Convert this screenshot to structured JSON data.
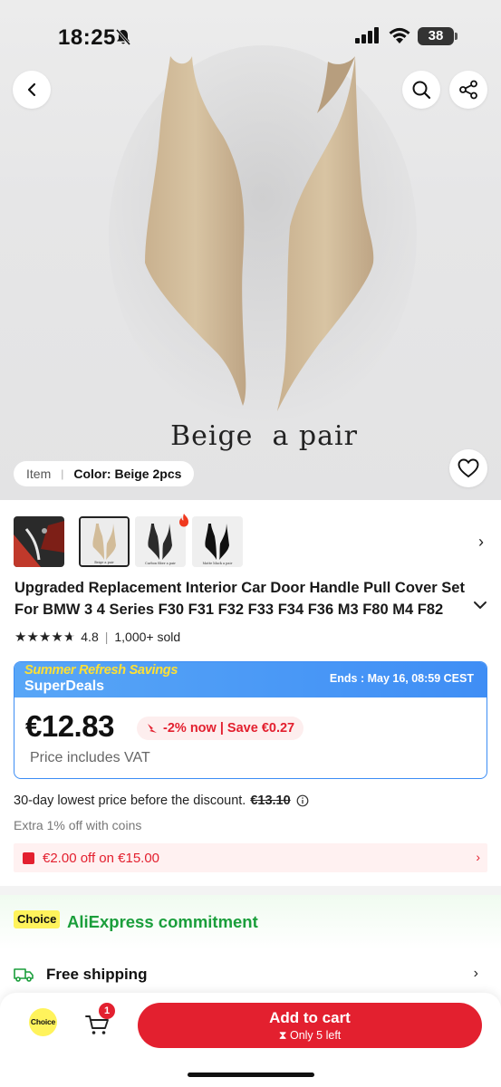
{
  "status_bar": {
    "time": "18:25",
    "battery": "38"
  },
  "hero": {
    "caption": "Beige  a pair",
    "variant_prefix": "Item",
    "variant_value": "Color: Beige 2pcs"
  },
  "thumbnails": [
    {
      "name": "car-interior",
      "caption": ""
    },
    {
      "name": "beige-pair",
      "caption": "Beige a pair"
    },
    {
      "name": "carbon-pair",
      "caption": "Carbon fiber a pair"
    },
    {
      "name": "black-pair",
      "caption": "Matte black a pair"
    }
  ],
  "product": {
    "title_line1": "Upgraded Replacement Interior Car Door Handle Pull Cover Set",
    "title_line2": "For BMW 3 4 Series F30 F31 F32 F33 F34 F36 M3 F80 M4 F82",
    "rating": "4.8",
    "sold": "1,000+ sold"
  },
  "deal": {
    "tag": "Summer Refresh Savings",
    "name": "SuperDeals",
    "ends": "Ends : May 16, 08:59 CEST",
    "price": "€12.83",
    "discount": "-2% now | Save €0.27",
    "vat": "Price includes VAT"
  },
  "lowest_price": {
    "label": "30-day lowest price before the discount.",
    "value": "€13.10"
  },
  "coins": "Extra 1% off with coins",
  "coupon": "€2.00 off on €15.00",
  "commitment": {
    "badge": "Choice",
    "title": "AliExpress commitment"
  },
  "shipping": {
    "label": "Free shipping"
  },
  "bottom_bar": {
    "choice_label": "Choice",
    "cart_count": "1",
    "add_to_cart": "Add to cart",
    "stock": "Only 5 left"
  },
  "colors": {
    "accent": "#e3202f",
    "deal_blue": "#3f8ef5",
    "green": "#1a9e3b",
    "choice_yellow": "#fff35c"
  }
}
